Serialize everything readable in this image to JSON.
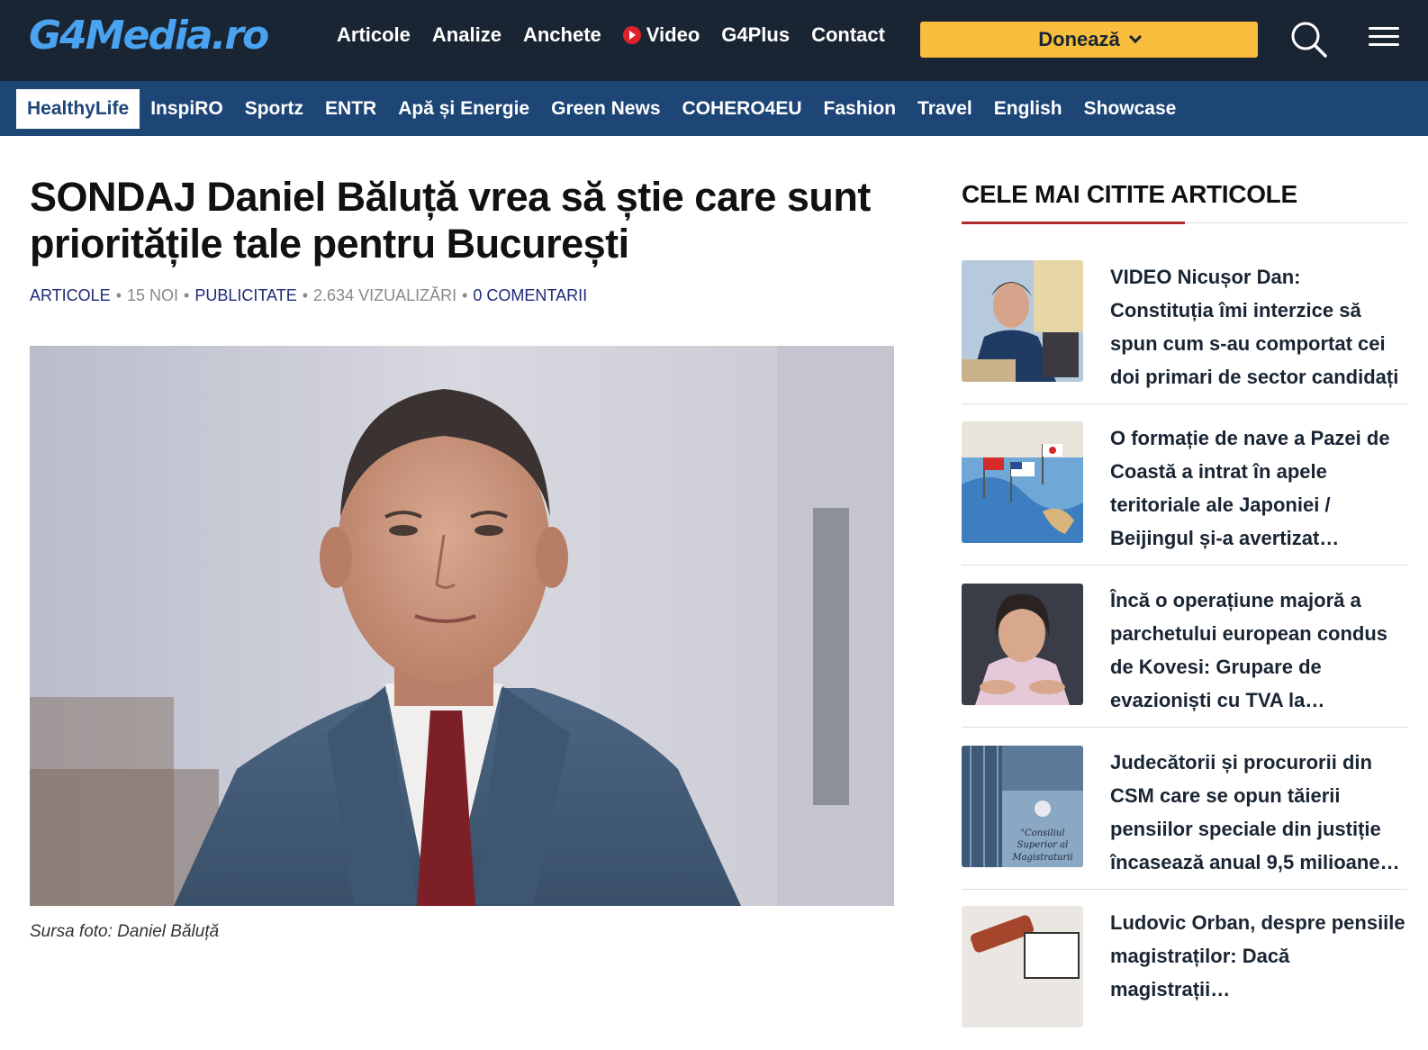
{
  "header": {
    "logo": "G4Media.ro",
    "nav": [
      {
        "label": "Articole"
      },
      {
        "label": "Analize"
      },
      {
        "label": "Anchete"
      },
      {
        "label": "Video",
        "icon": "play-icon"
      },
      {
        "label": "G4Plus"
      },
      {
        "label": "Contact"
      }
    ],
    "donate_label": "Donează",
    "colors": {
      "topbar": "#1a2533",
      "subbar": "#1d4677",
      "donate": "#f8bd3c",
      "logo": "#4aa3f0"
    }
  },
  "subnav": {
    "items": [
      {
        "label": "HealthyLife",
        "active": true
      },
      {
        "label": "InspiRO"
      },
      {
        "label": "Sportz"
      },
      {
        "label": "ENTR"
      },
      {
        "label": "Apă și Energie"
      },
      {
        "label": "Green News"
      },
      {
        "label": "COHERO4EU"
      },
      {
        "label": "Fashion"
      },
      {
        "label": "Travel"
      },
      {
        "label": "English"
      },
      {
        "label": "Showcase"
      }
    ]
  },
  "article": {
    "title": "SONDAJ Daniel Băluță vrea să știe care sunt prioritățile tale pentru București",
    "meta": {
      "category": "ARTICOLE",
      "date": "15 NOI",
      "tag": "PUBLICITATE",
      "views": "2.634 VIZUALIZĂRI",
      "comments": "0 COMENTARII"
    },
    "caption": "Sursa foto: Daniel Băluță"
  },
  "sidebar": {
    "title": "CELE MAI CITITE ARTICOLE",
    "items": [
      {
        "title": "VIDEO Nicușor Dan: Constituția îmi interzice să spun cum s-au comportat cei doi primari de sector candidați la Primăria…"
      },
      {
        "title": "O formație de nave a Pazei de Coastă a intrat în apele teritoriale ale Japoniei / Beijingul și-a avertizat…"
      },
      {
        "title": "Încă o operațiune majoră a parchetului european condus de Kovesi: Grupare de evazioniști cu TVA la…"
      },
      {
        "title": "Judecătorii și procurorii din CSM care se opun tăierii pensiilor speciale din justiție încasează anual 9,5 milioane…",
        "thumb_text": "\"Consiliul Superior al Magistraturii"
      },
      {
        "title": "Ludovic Orban, despre pensiile magistraților: Dacă magistrații…"
      }
    ]
  }
}
